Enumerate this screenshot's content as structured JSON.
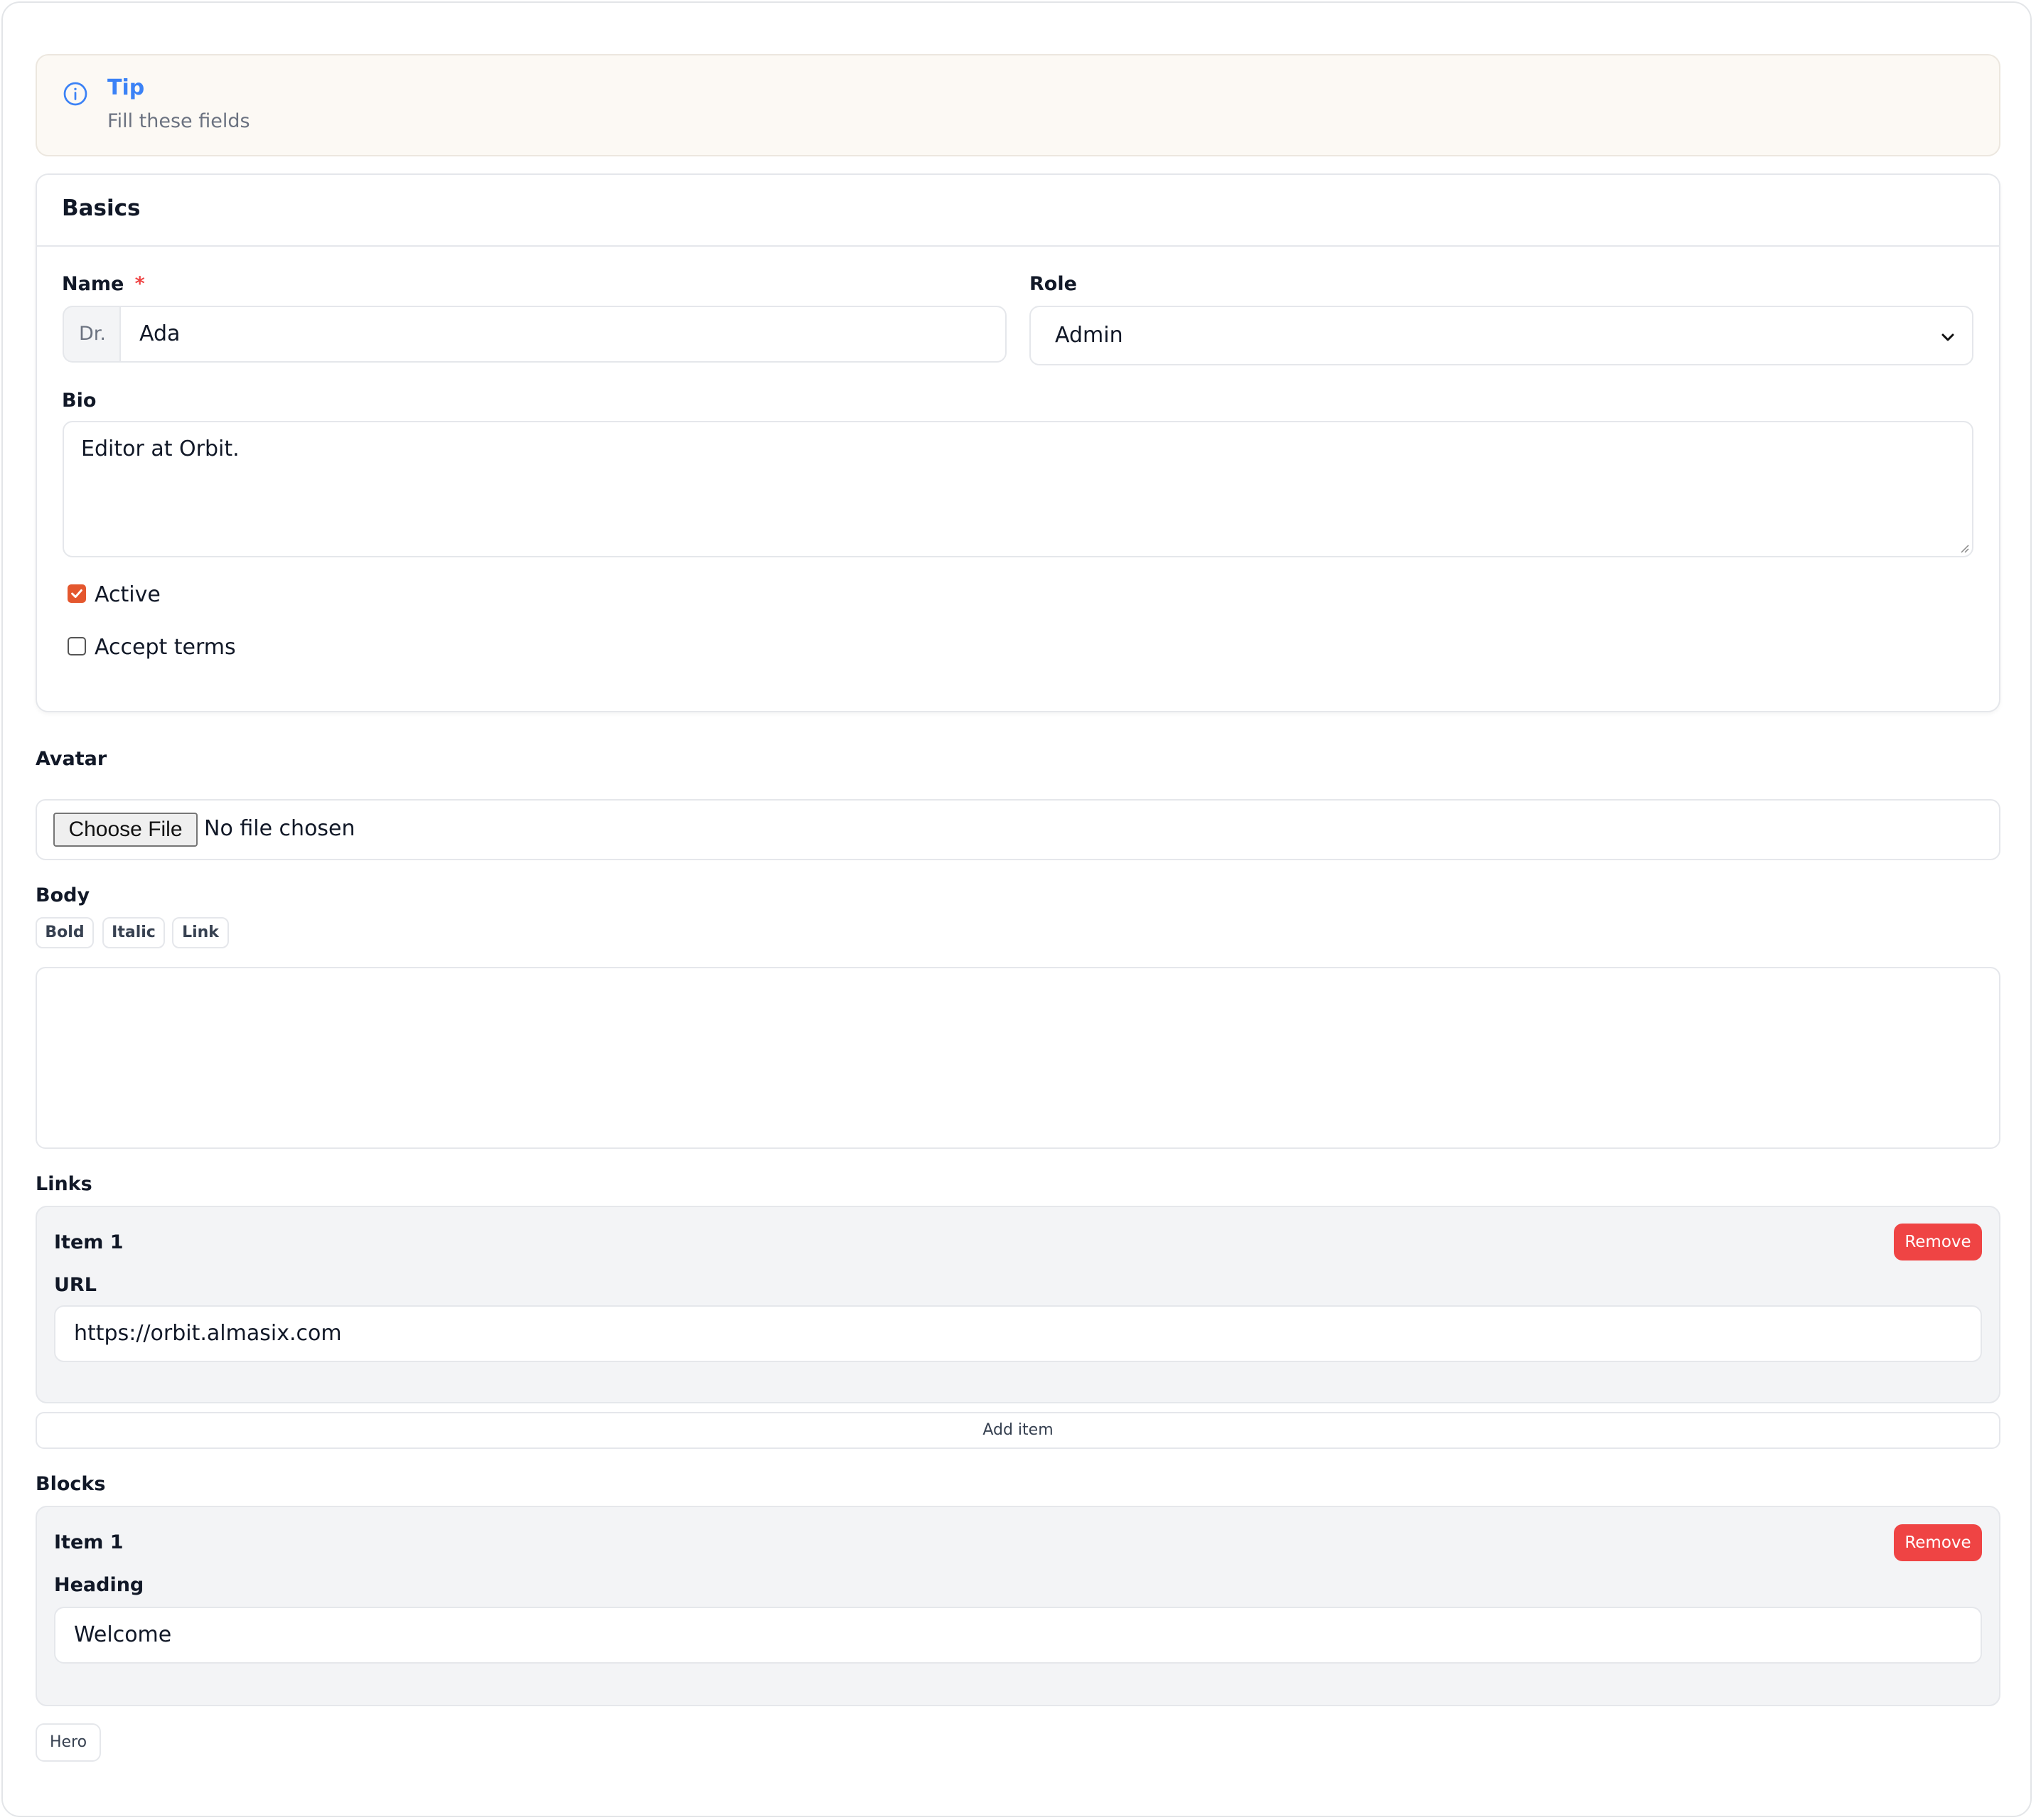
{
  "tip": {
    "title": "Tip",
    "text": "Fill these fields",
    "icon": "info-icon"
  },
  "basics": {
    "title": "Basics",
    "name": {
      "label": "Name",
      "required_mark": "*",
      "prefix": "Dr.",
      "value": "Ada"
    },
    "role": {
      "label": "Role",
      "value": "Admin"
    },
    "bio": {
      "label": "Bio",
      "value": "Editor at Orbit."
    },
    "checkboxes": [
      {
        "label": "Active",
        "checked": true
      },
      {
        "label": "Accept terms",
        "checked": false
      }
    ]
  },
  "avatar": {
    "label": "Avatar",
    "button_label": "Choose File",
    "status": "No file chosen"
  },
  "body": {
    "label": "Body",
    "toolbar": [
      "Bold",
      "Italic",
      "Link"
    ],
    "value": ""
  },
  "links": {
    "label": "Links",
    "items": [
      {
        "title": "Item 1",
        "field_label": "URL",
        "value": "https://orbit.almasix.com",
        "remove_label": "Remove"
      }
    ],
    "add_label": "Add item"
  },
  "blocks": {
    "label": "Blocks",
    "items": [
      {
        "title": "Item 1",
        "field_label": "Heading",
        "value": "Welcome",
        "remove_label": "Remove"
      }
    ],
    "add_options": [
      "Hero"
    ]
  },
  "colors": {
    "accent": "#3b82f6",
    "danger": "#ef4444",
    "checkbox": "#e4572e",
    "tip_bg": "#fcf9f4",
    "repeater_bg": "#f3f4f6"
  }
}
